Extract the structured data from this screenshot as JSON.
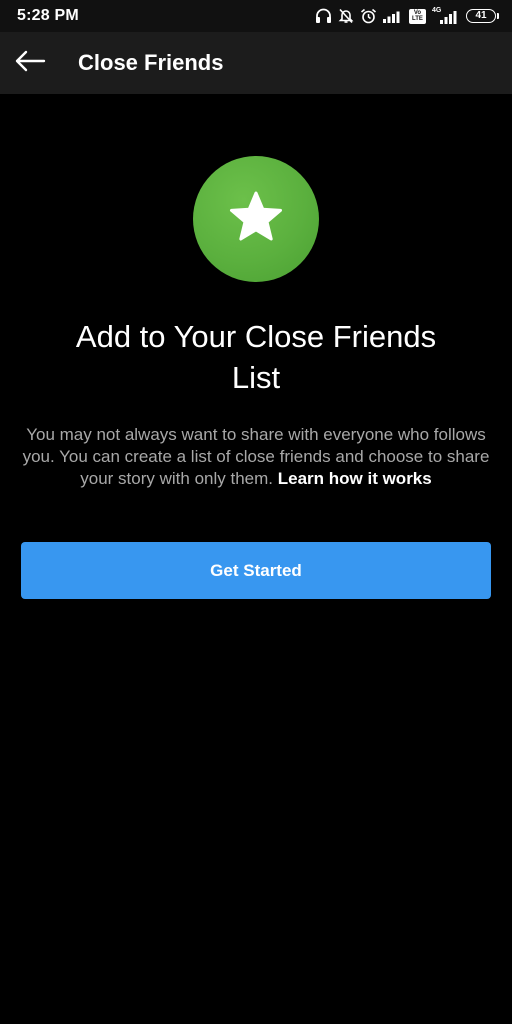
{
  "status_bar": {
    "time": "5:28 PM",
    "icons": [
      "headphones-icon",
      "bell-muted-icon",
      "alarm-icon",
      "signal-icon",
      "volte-icon",
      "4g-signal-icon",
      "battery-icon"
    ],
    "volte_top": "Vo",
    "volte_bottom": "LTE",
    "network_label": "4G",
    "battery_level": "41"
  },
  "header": {
    "back_icon": "arrow-left-icon",
    "title": "Close Friends"
  },
  "main": {
    "badge_icon": "star-icon",
    "badge_color": "#5bb03e",
    "headline": "Add to Your Close Friends List",
    "description": "You may not always want to share with everyone who follows you. You can create a list of close friends and choose to share your story with only them.",
    "learn_link": "Learn how it works",
    "button_label": "Get Started",
    "button_color": "#3897f0"
  }
}
